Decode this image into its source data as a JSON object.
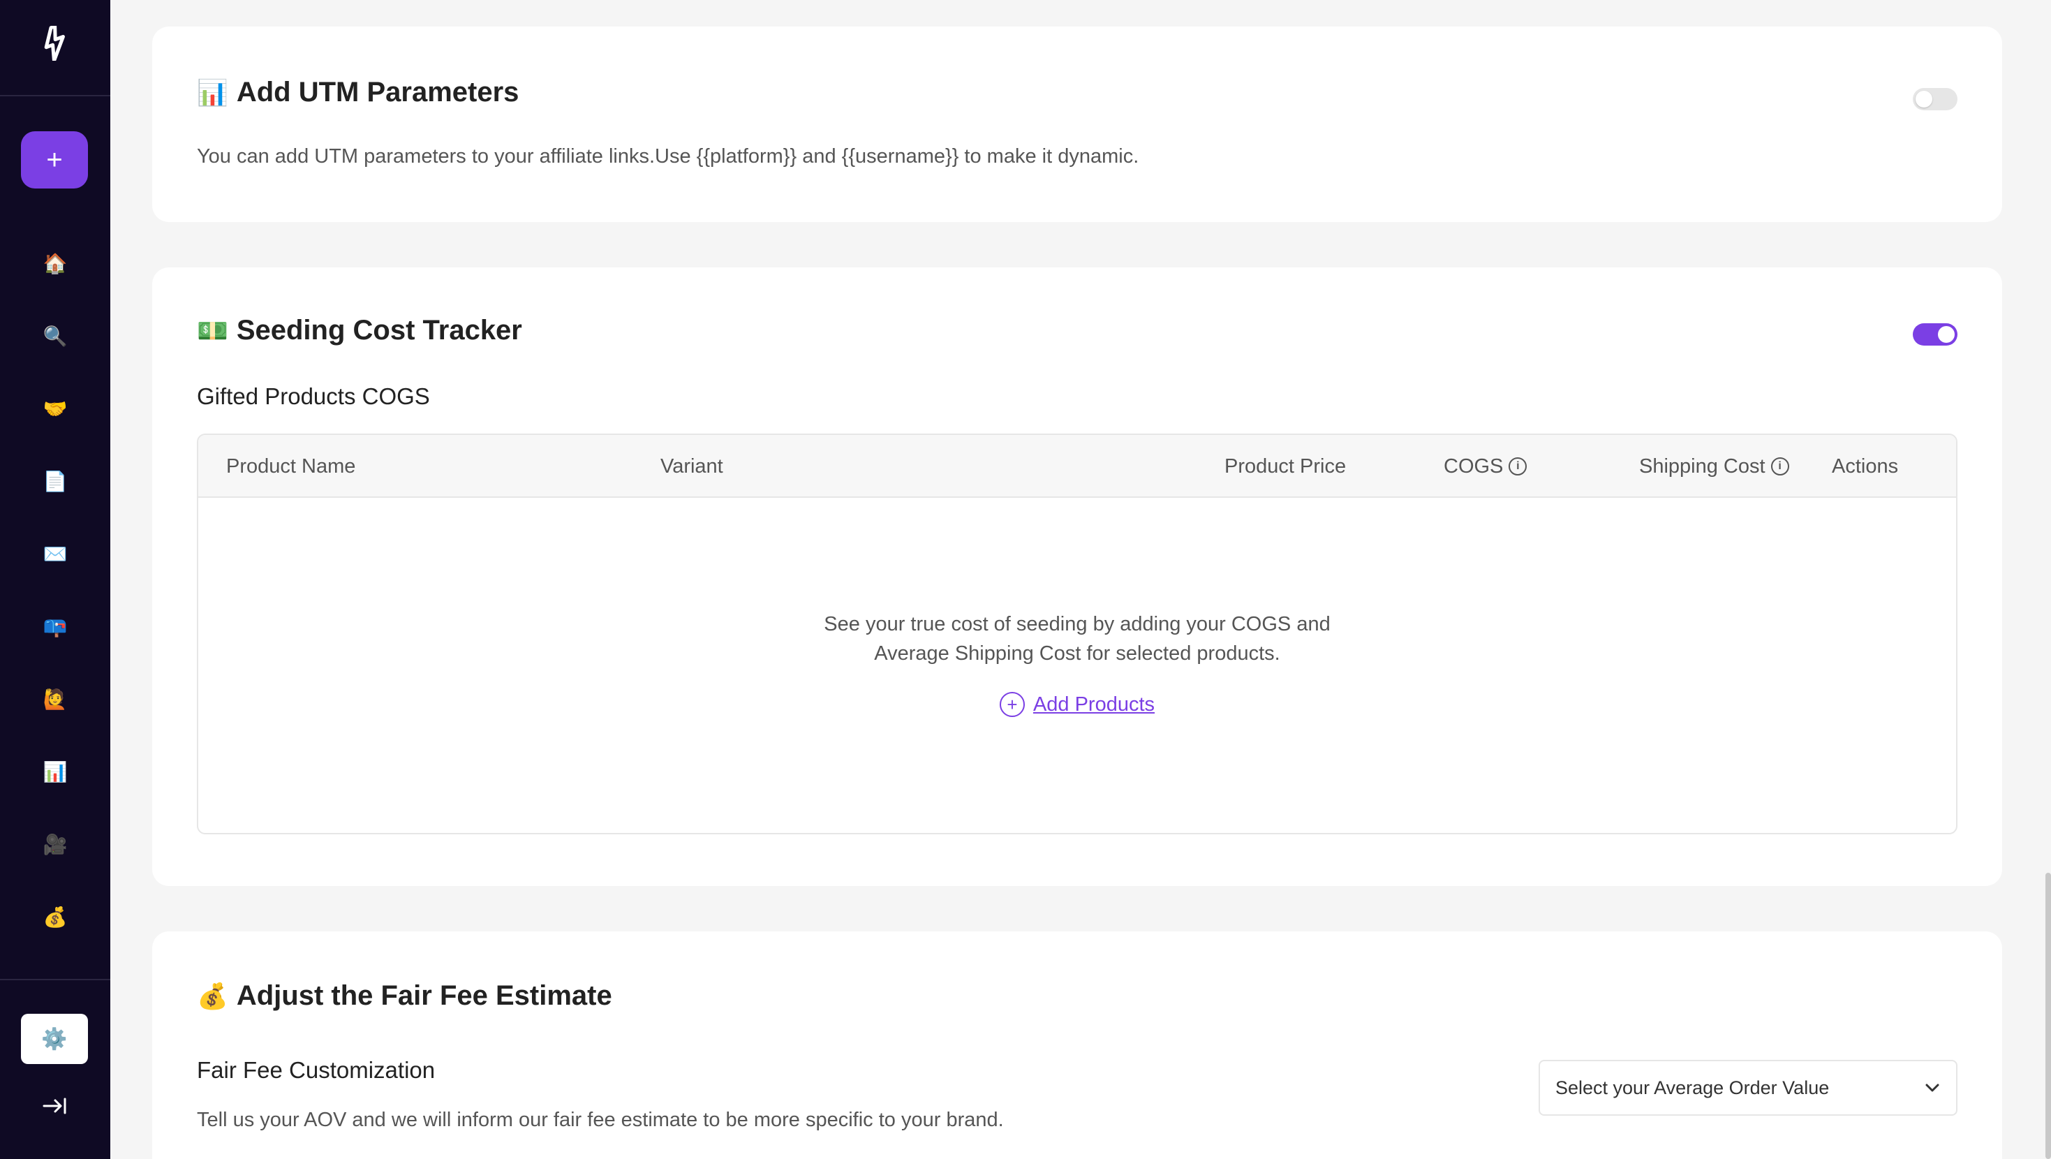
{
  "sidebar": {
    "add_label": "+",
    "items": [
      {
        "name": "home-icon",
        "glyph": "🏠"
      },
      {
        "name": "search-icon",
        "glyph": "🔍"
      },
      {
        "name": "handshake-icon",
        "glyph": "🤝"
      },
      {
        "name": "document-icon",
        "glyph": "📄"
      },
      {
        "name": "envelope-icon",
        "glyph": "✉️"
      },
      {
        "name": "mailbox-icon",
        "glyph": "📪"
      },
      {
        "name": "person-icon",
        "glyph": "🙋"
      },
      {
        "name": "chart-icon",
        "glyph": "📊"
      },
      {
        "name": "video-camera-icon",
        "glyph": "🎥"
      },
      {
        "name": "money-bag-icon",
        "glyph": "💰"
      }
    ],
    "settings_glyph": "⚙️"
  },
  "utm": {
    "emoji": "📊",
    "title": "Add UTM Parameters",
    "description": "You can add UTM parameters to your affiliate links.Use {{platform}} and {{username}} to make it dynamic.",
    "enabled": false
  },
  "seeding": {
    "emoji": "💵",
    "title": "Seeding Cost Tracker",
    "enabled": true,
    "subtitle": "Gifted Products COGS",
    "columns": {
      "product_name": "Product Name",
      "variant": "Variant",
      "product_price": "Product Price",
      "cogs": "COGS",
      "shipping_cost": "Shipping Cost",
      "actions": "Actions"
    },
    "empty_line1": "See your true cost of seeding by adding your COGS and",
    "empty_line2": "Average Shipping Cost for selected products.",
    "add_products_label": "Add Products"
  },
  "fair_fee": {
    "emoji": "💰",
    "title": "Adjust the Fair Fee Estimate",
    "subtitle": "Fair Fee Customization",
    "description": "Tell us your AOV and we will inform our fair fee estimate to be more specific to your brand.",
    "select_placeholder": "Select your Average Order Value"
  },
  "colors": {
    "sidebar_bg": "#0f0a24",
    "accent": "#7b3fe4"
  }
}
